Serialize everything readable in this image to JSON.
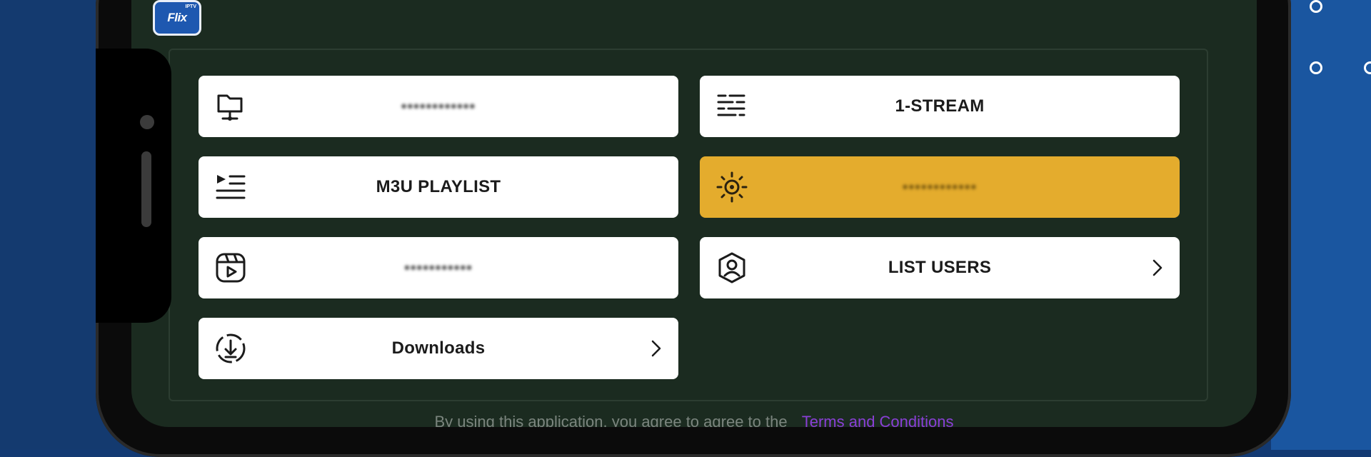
{
  "app": {
    "logo_text": "Flix",
    "logo_badge": "IPTV"
  },
  "menu": {
    "items": [
      {
        "label": "••••••••••••",
        "icon": "network-folder-icon",
        "blurred": true
      },
      {
        "label": "1-STREAM",
        "icon": "stream-list-icon"
      },
      {
        "label": "M3U PLAYLIST",
        "icon": "playlist-icon"
      },
      {
        "label": "••••••••••••",
        "icon": "sun-settings-icon",
        "blurred": true,
        "accent": "#e4ac2d"
      },
      {
        "label": "•••••••••••",
        "icon": "video-reel-icon",
        "blurred": true
      },
      {
        "label": "LIST USERS",
        "icon": "user-shield-icon",
        "has_chevron": true
      },
      {
        "label": "Downloads",
        "icon": "download-icon",
        "has_chevron": true
      }
    ]
  },
  "footer": {
    "text": "By using this application, you agree to agree to the",
    "link": "Terms and Conditions",
    "link_color": "#8a3fd6"
  },
  "colors": {
    "screen_bg": "#1b2b20",
    "button_bg": "#ffffff",
    "accent": "#e4ac2d",
    "page_bg": "#133a73"
  }
}
